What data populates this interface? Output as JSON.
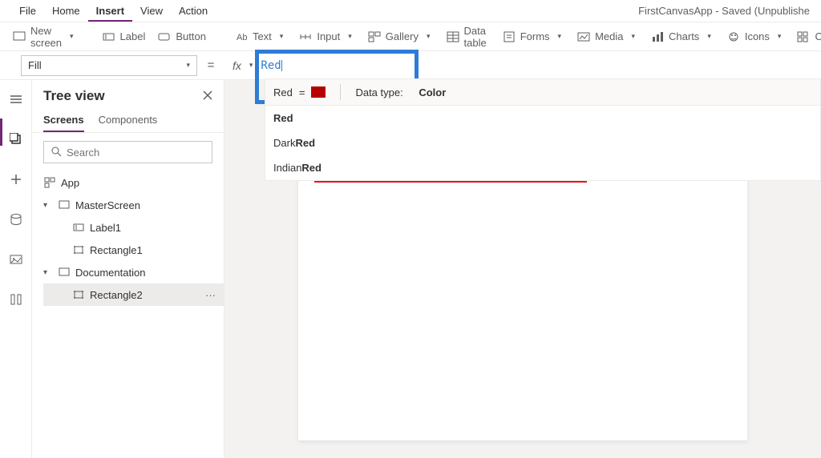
{
  "header": {
    "menu": [
      "File",
      "Home",
      "Insert",
      "View",
      "Action"
    ],
    "active_menu_index": 2,
    "app_title": "FirstCanvasApp - Saved (Unpublishe"
  },
  "ribbon": {
    "new_screen": "New screen",
    "label": "Label",
    "button": "Button",
    "text": "Text",
    "input": "Input",
    "gallery": "Gallery",
    "data_table": "Data table",
    "forms": "Forms",
    "media": "Media",
    "charts": "Charts",
    "icons": "Icons",
    "custom": "Custom"
  },
  "formula": {
    "property": "Fill",
    "fx": "fx",
    "expression": "Red",
    "data_type_label": "Data type:",
    "data_type_value": "Color",
    "suggest_preview_label": "Red",
    "suggestions": [
      {
        "prefix": "",
        "match": "Red"
      },
      {
        "prefix": "Dark",
        "match": "Red"
      },
      {
        "prefix": "Indian",
        "match": "Red"
      }
    ]
  },
  "panel": {
    "title": "Tree view",
    "tabs": [
      "Screens",
      "Components"
    ],
    "active_tab_index": 0,
    "search_placeholder": "Search",
    "tree": {
      "app": "App",
      "master_screen": "MasterScreen",
      "label1": "Label1",
      "rect1": "Rectangle1",
      "documentation": "Documentation",
      "rect2": "Rectangle2"
    }
  },
  "colors": {
    "accent": "#742774",
    "highlight": "#2e7cd6",
    "red_fill": "#e81123"
  }
}
